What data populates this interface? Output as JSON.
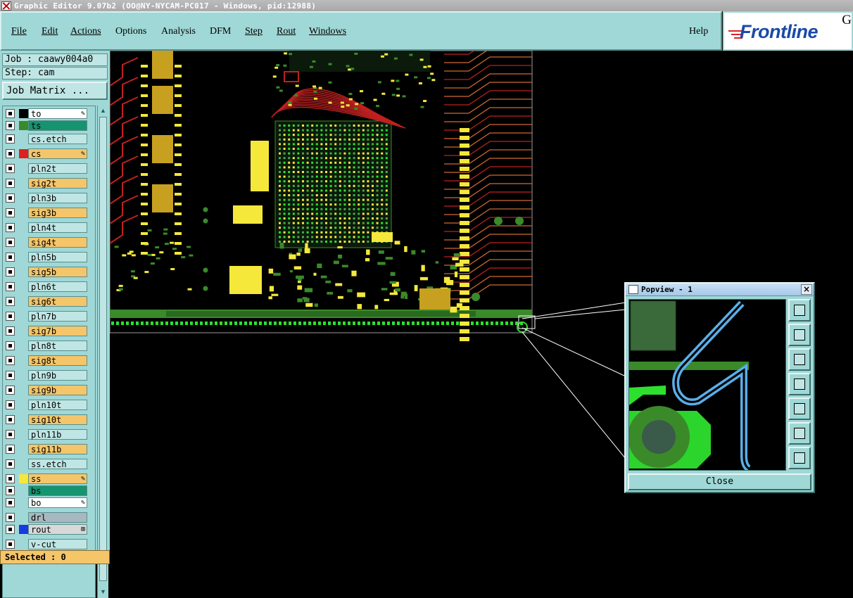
{
  "window": {
    "title": "Graphic Editor 9.07b2 (OO@NY-NYCAM-PC017 - Windows, pid:12988)"
  },
  "menu": {
    "items": [
      "File",
      "Edit",
      "Actions",
      "Options",
      "Analysis",
      "DFM",
      "Step",
      "Rout",
      "Windows"
    ],
    "help": "Help"
  },
  "logo": {
    "brand": "Frontline",
    "trailing": "G"
  },
  "job": {
    "job_label": "Job : caawy004a0",
    "step_label": "Step: cam",
    "matrix_button": "Job Matrix ..."
  },
  "layers": [
    {
      "name": "to",
      "color": "#ffffff",
      "swatch": "#000000",
      "pen": true
    },
    {
      "name": "ts",
      "color": "#16936f",
      "swatch": "#3a8a2a",
      "pen": false
    },
    {
      "name": "cs.etch",
      "color": "#bfe6e4",
      "swatch": "",
      "pen": false
    },
    {
      "name": "cs",
      "color": "#f5c56a",
      "swatch": "#e02020",
      "pen": true
    },
    {
      "name": "pln2t",
      "color": "#bfe6e4",
      "swatch": "",
      "pen": false
    },
    {
      "name": "sig2t",
      "color": "#f5c56a",
      "swatch": "",
      "pen": false
    },
    {
      "name": "pln3b",
      "color": "#bfe6e4",
      "swatch": "",
      "pen": false
    },
    {
      "name": "sig3b",
      "color": "#f5c56a",
      "swatch": "",
      "pen": false
    },
    {
      "name": "pln4t",
      "color": "#bfe6e4",
      "swatch": "",
      "pen": false
    },
    {
      "name": "sig4t",
      "color": "#f5c56a",
      "swatch": "",
      "pen": false
    },
    {
      "name": "pln5b",
      "color": "#bfe6e4",
      "swatch": "",
      "pen": false
    },
    {
      "name": "sig5b",
      "color": "#f5c56a",
      "swatch": "",
      "pen": false
    },
    {
      "name": "pln6t",
      "color": "#bfe6e4",
      "swatch": "",
      "pen": false
    },
    {
      "name": "sig6t",
      "color": "#f5c56a",
      "swatch": "",
      "pen": false
    },
    {
      "name": "pln7b",
      "color": "#bfe6e4",
      "swatch": "",
      "pen": false
    },
    {
      "name": "sig7b",
      "color": "#f5c56a",
      "swatch": "",
      "pen": false
    },
    {
      "name": "pln8t",
      "color": "#bfe6e4",
      "swatch": "",
      "pen": false
    },
    {
      "name": "sig8t",
      "color": "#f5c56a",
      "swatch": "",
      "pen": false
    },
    {
      "name": "pln9b",
      "color": "#bfe6e4",
      "swatch": "",
      "pen": false
    },
    {
      "name": "sig9b",
      "color": "#f5c56a",
      "swatch": "",
      "pen": false
    },
    {
      "name": "pln10t",
      "color": "#bfe6e4",
      "swatch": "",
      "pen": false
    },
    {
      "name": "sig10t",
      "color": "#f5c56a",
      "swatch": "",
      "pen": false
    },
    {
      "name": "pln11b",
      "color": "#bfe6e4",
      "swatch": "",
      "pen": false
    },
    {
      "name": "sig11b",
      "color": "#f5c56a",
      "swatch": "",
      "pen": false
    },
    {
      "name": "ss.etch",
      "color": "#bfe6e4",
      "swatch": "",
      "pen": false
    },
    {
      "name": "ss",
      "color": "#f5c56a",
      "swatch": "#f5e83a",
      "pen": true
    },
    {
      "name": "bs",
      "color": "#16936f",
      "swatch": "",
      "pen": false
    },
    {
      "name": "bo",
      "color": "#ffffff",
      "swatch": "",
      "pen": true
    },
    {
      "name": "drl",
      "color": "#a8b8c0",
      "swatch": "",
      "pen": false
    },
    {
      "name": "rout",
      "color": "#d8d8d8",
      "swatch": "#1a3ae0",
      "pen": false,
      "grid": true
    },
    {
      "name": "v-cut",
      "color": "#bfe6e4",
      "swatch": "",
      "pen": false
    }
  ],
  "status": {
    "selected": "Selected : 0"
  },
  "popview": {
    "title": "Popview - 1",
    "close_button": "Close"
  },
  "colors": {
    "panel": "#9fd8d6",
    "board_yellow": "#f5e83a",
    "board_green": "#3a8a2a",
    "board_dark": "#2a6a20",
    "trace_red": "#c02020",
    "trace_blue": "#5aaee8"
  }
}
